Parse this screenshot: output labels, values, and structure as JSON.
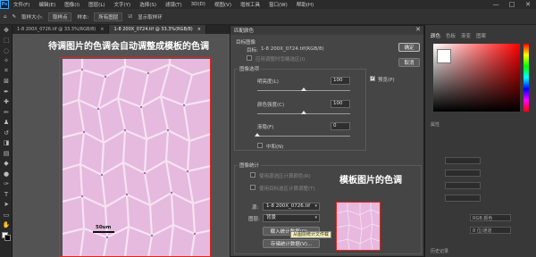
{
  "app": {
    "logo": "Ps"
  },
  "menu": [
    "文件(F)",
    "编辑(E)",
    "图像(I)",
    "图层(L)",
    "文字(Y)",
    "选择(S)",
    "滤镜(T)",
    "3D(D)",
    "视图(V)",
    "增效工具",
    "窗口(W)",
    "帮助(H)"
  ],
  "window_controls": {
    "minimize": "—",
    "maximize": "□",
    "close": "✕"
  },
  "options_bar": {
    "sample_label": "取样大小:",
    "sample_value": "取样点",
    "sample_all_label": "样本:",
    "sample_all_value": "所有图层",
    "show_ring_label": "显示取样环"
  },
  "tabs": [
    {
      "label": "1-8 200X_0726.tif @ 33.3%(RGB/8)",
      "close": "×",
      "active": false
    },
    {
      "label": "1-8 200X_0724.tif @ 33.3%(RGB/8)",
      "close": "×",
      "active": true
    }
  ],
  "annotations": {
    "canvas_note": "待调图片的色调会自动调整成模板的色调",
    "thumb_note": "模板图片的色调",
    "scale_label": "50um"
  },
  "dialog": {
    "title": "匹配颜色",
    "close": "✕",
    "target_section": "目标图像",
    "target_label": "目标:",
    "target_value": "1-8 200X_0724.tif(RGB/8)",
    "ignore_selection": "应用调整时忽略选区(I)",
    "image_options": "图像选项",
    "luminance_label": "明亮度(L)",
    "luminance_value": "100",
    "luminance_level": 0.5,
    "color_intensity_label": "颜色强度(C)",
    "color_intensity_value": "100",
    "color_intensity_level": 0.5,
    "fade_label": "渐隐(F)",
    "fade_value": "0",
    "fade_level": 0,
    "neutralize_label": "中和(N)",
    "image_stats": "图像统计",
    "use_source_sel": "使用源选区计算颜色(R)",
    "use_target_sel": "使用目标选区计算调整(T)",
    "source_label": "源:",
    "source_value": "1-8 200X_0726.tif",
    "layer_label": "图层:",
    "layer_value": "背景",
    "load_stats": "载入统计数据(O)...",
    "save_stats": "存储统计数据(V)...",
    "ok": "确定",
    "cancel": "取消",
    "preview_label": "预览(P)"
  },
  "tooltip": "从图层统计文件载",
  "right_panel": {
    "tabs": [
      "颜色",
      "色板",
      "渐变",
      "图案"
    ],
    "props_label": "属性",
    "mode_label": "RGB 颜色",
    "bit_label": "8 位/通道",
    "layers_label": "历史记录"
  }
}
